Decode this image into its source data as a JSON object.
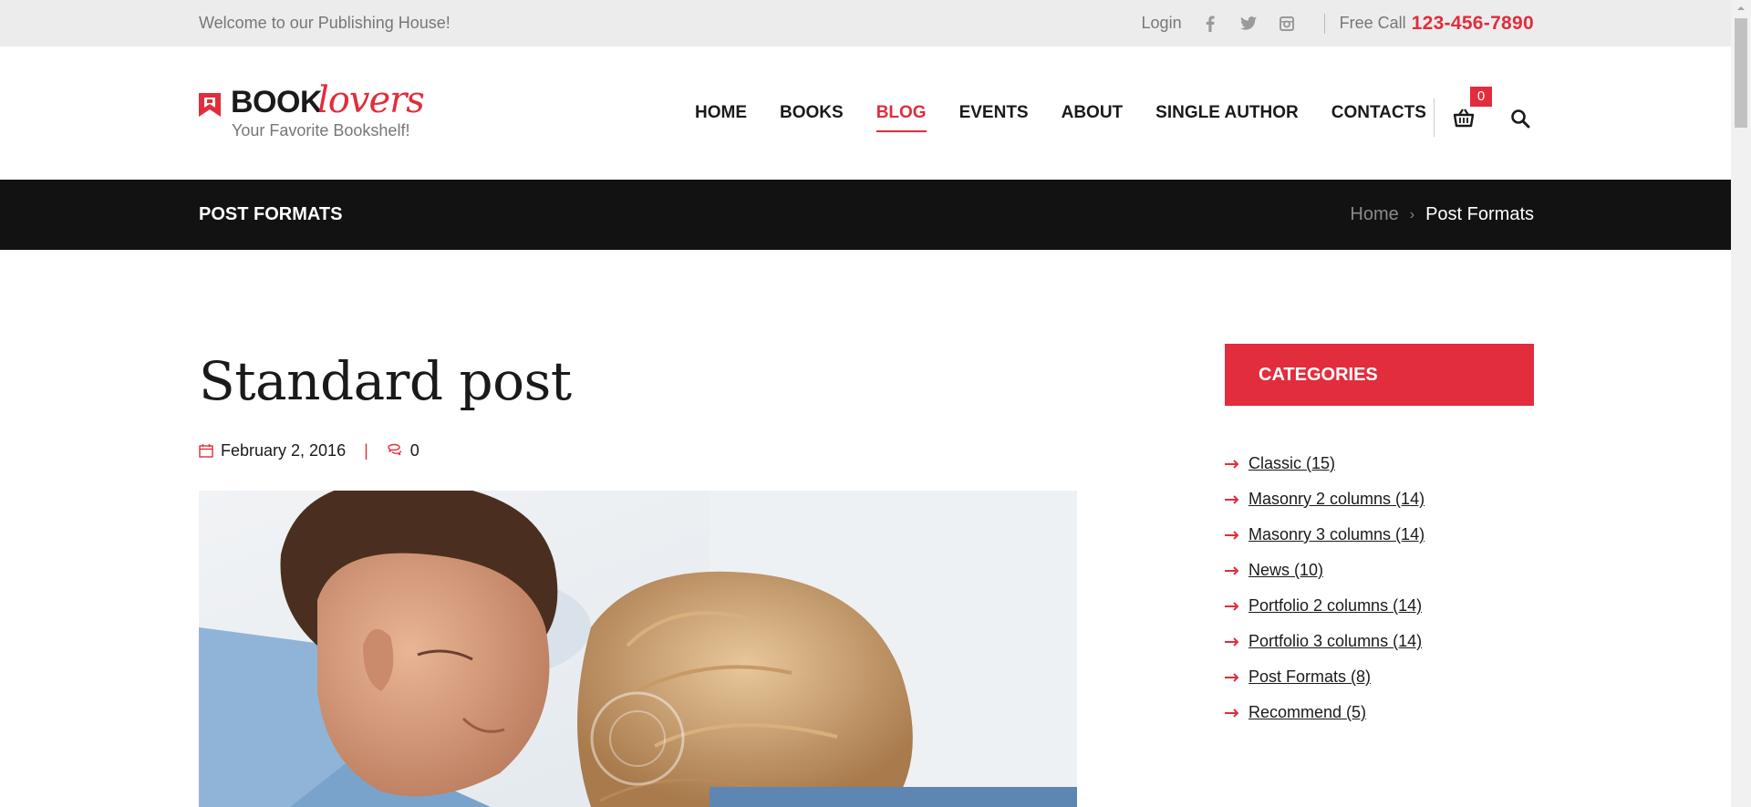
{
  "topbar": {
    "welcome": "Welcome to our Publishing House!",
    "login": "Login",
    "social": [
      "facebook-icon",
      "twitter-icon",
      "instagram-icon"
    ],
    "call_label": "Free Call",
    "phone": "123-456-7890"
  },
  "logo": {
    "book": "BOOK",
    "lovers": "lovers",
    "tagline": "Your Favorite Bookshelf!"
  },
  "nav": {
    "items": [
      {
        "label": "HOME",
        "active": false
      },
      {
        "label": "BOOKS",
        "active": false
      },
      {
        "label": "BLOG",
        "active": true
      },
      {
        "label": "EVENTS",
        "active": false
      },
      {
        "label": "ABOUT",
        "active": false
      },
      {
        "label": "SINGLE AUTHOR",
        "active": false
      },
      {
        "label": "CONTACTS",
        "active": false
      }
    ],
    "cart_count": "0"
  },
  "titlebar": {
    "title": "POST FORMATS",
    "breadcrumb_home": "Home",
    "breadcrumb_current": "Post Formats"
  },
  "post": {
    "title": "Standard post",
    "date": "February 2, 2016",
    "comments": "0"
  },
  "sidebar": {
    "heading": "CATEGORIES",
    "categories": [
      "Classic (15)",
      "Masonry 2 columns (14)",
      "Masonry 3 columns (14)",
      "News (10)",
      "Portfolio 2 columns (14)",
      "Portfolio 3 columns (14)",
      "Post Formats (8)",
      "Recommend (5)"
    ]
  },
  "colors": {
    "accent": "#e12d3c",
    "dark": "#121212",
    "topbar_bg": "#ececec"
  }
}
